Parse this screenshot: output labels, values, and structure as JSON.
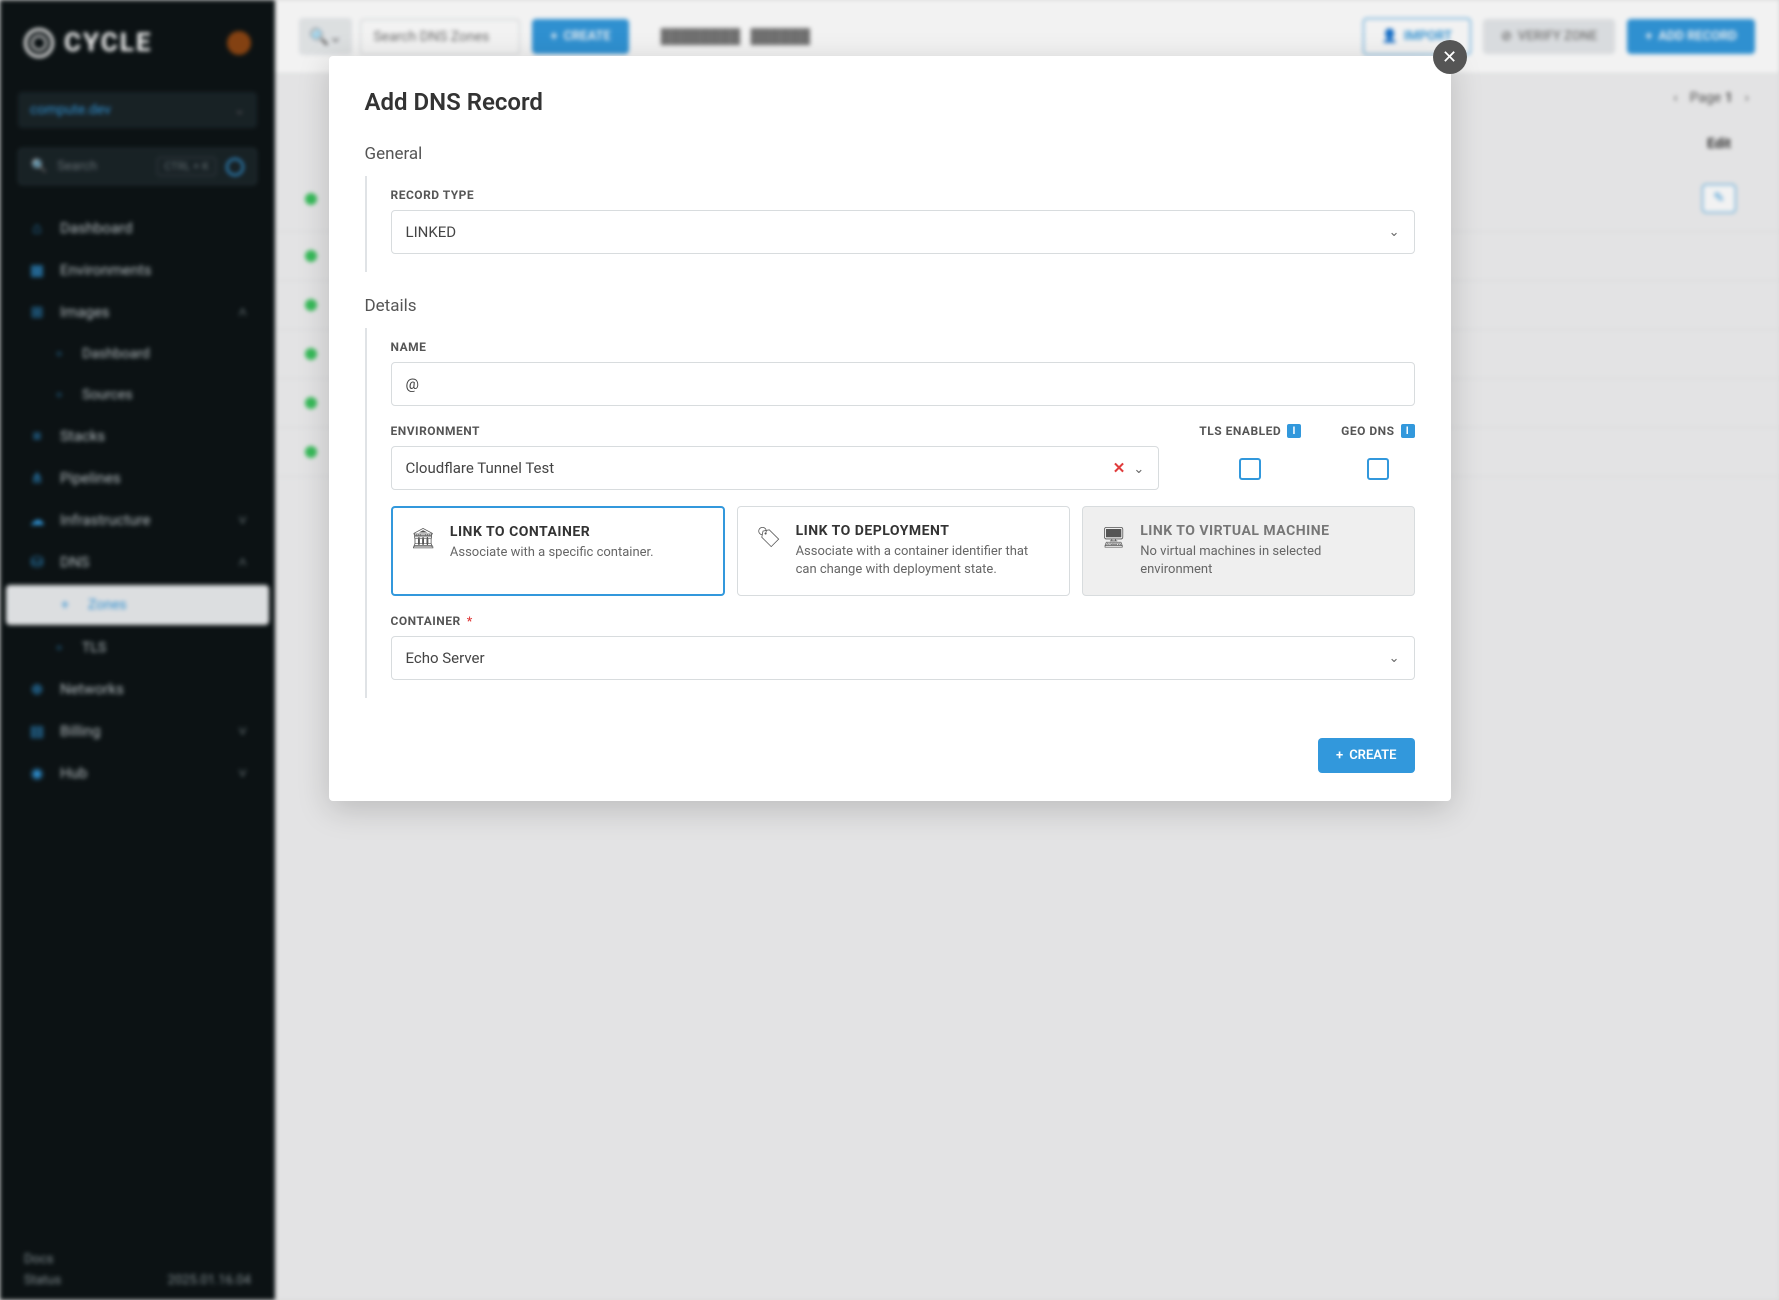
{
  "brand": "CYCLE",
  "hub_selector": "compute.dev",
  "search": {
    "placeholder": "Search",
    "kbd": "CTRL + K"
  },
  "nav": [
    {
      "label": "Dashboard",
      "icon": "⌂"
    },
    {
      "label": "Environments",
      "icon": "▦"
    },
    {
      "label": "Images",
      "icon": "⊞",
      "expanded": true,
      "children": [
        {
          "label": "Dashboard"
        },
        {
          "label": "Sources"
        }
      ]
    },
    {
      "label": "Stacks",
      "icon": "≡"
    },
    {
      "label": "Pipelines",
      "icon": "⋔"
    },
    {
      "label": "Infrastructure",
      "icon": "☁",
      "expandable": true
    },
    {
      "label": "DNS",
      "icon": "⛁",
      "expanded": true,
      "children": [
        {
          "label": "Zones",
          "active": true
        },
        {
          "label": "TLS"
        }
      ]
    },
    {
      "label": "Networks",
      "icon": "⊕"
    },
    {
      "label": "Billing",
      "icon": "▤",
      "expandable": true
    },
    {
      "label": "Hub",
      "icon": "◉",
      "expandable": true
    }
  ],
  "footer": {
    "docs": "Docs",
    "status": "Status",
    "version": "2025.01.16.04"
  },
  "topbar": {
    "search_placeholder": "Search DNS Zones",
    "create": "CREATE",
    "import": "IMPORT",
    "verify": "VERIFY ZONE",
    "add_record": "ADD RECORD"
  },
  "pager": {
    "label": "Page",
    "num": "1"
  },
  "table": {
    "edit_header": "Edit"
  },
  "modal": {
    "title": "Add DNS Record",
    "section_general": "General",
    "section_details": "Details",
    "record_type_label": "RECORD TYPE",
    "record_type_value": "LINKED",
    "name_label": "NAME",
    "name_value": "@",
    "env_label": "ENVIRONMENT",
    "env_value": "Cloudflare Tunnel Test",
    "tls_label": "TLS ENABLED",
    "geo_label": "GEO DNS",
    "link_options": [
      {
        "title": "LINK TO CONTAINER",
        "desc": "Associate with a specific container.",
        "icon": "🏛",
        "selected": true
      },
      {
        "title": "LINK TO DEPLOYMENT",
        "desc": "Associate with a container identifier that can change with deployment state.",
        "icon": "🏷"
      },
      {
        "title": "LINK TO VIRTUAL MACHINE",
        "desc": "No virtual machines in selected environment",
        "icon": "🖥",
        "disabled": true
      }
    ],
    "container_label": "CONTAINER",
    "container_value": "Echo Server",
    "create_btn": "CREATE"
  }
}
